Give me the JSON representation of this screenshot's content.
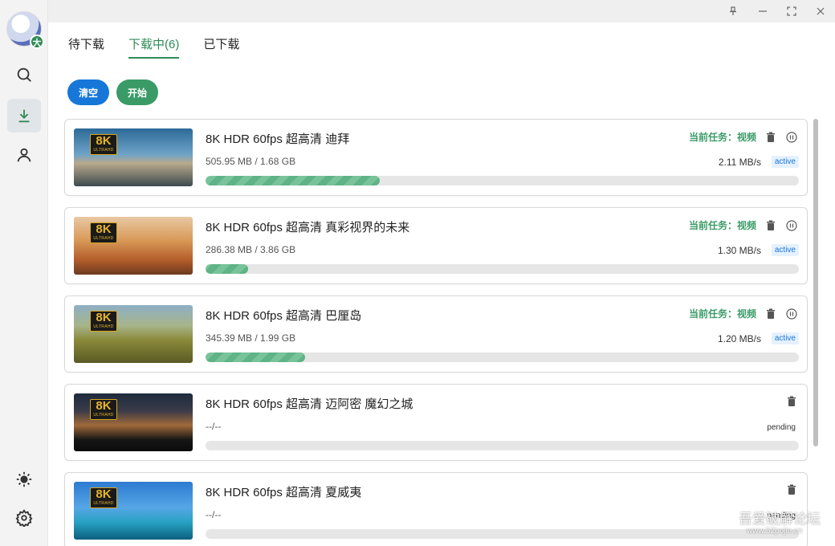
{
  "colors": {
    "accent": "#2e8b57",
    "blue": "#1677d9",
    "green_button": "#3a9b67",
    "sidebar_bg": "#f3f3f3"
  },
  "sidebar": {
    "avatar_badge": "大",
    "items": [
      {
        "icon": "search-icon"
      },
      {
        "icon": "download-icon"
      },
      {
        "icon": "user-icon"
      }
    ],
    "bottom_items": [
      {
        "icon": "sun-icon"
      },
      {
        "icon": "gear-icon"
      }
    ]
  },
  "window_controls": [
    "pin-icon",
    "minimize-icon",
    "restore-icon",
    "close-icon"
  ],
  "tabs": [
    {
      "label": "待下载"
    },
    {
      "label": "下载中(6)"
    },
    {
      "label": "已下载"
    }
  ],
  "actions": {
    "clear_label": "清空",
    "start_label": "开始"
  },
  "badge": {
    "big": "8K",
    "small": "ULTRAHD"
  },
  "downloads": [
    {
      "title": "8K HDR 60fps 超高清 迪拜",
      "size": "505.95 MB / 1.68 GB",
      "task_label": "当前任务：视频",
      "speed": "2.11 MB/s",
      "status": "active",
      "progress": 0.293
    },
    {
      "title": "8K HDR 60fps 超高清 真彩视界的未来",
      "size": "286.38 MB / 3.86 GB",
      "task_label": "当前任务：视频",
      "speed": "1.30 MB/s",
      "status": "active",
      "progress": 0.072
    },
    {
      "title": "8K HDR 60fps 超高清 巴厘岛",
      "size": "345.39 MB / 1.99 GB",
      "task_label": "当前任务：视频",
      "speed": "1.20 MB/s",
      "status": "active",
      "progress": 0.168
    },
    {
      "title": "8K HDR 60fps 超高清 迈阿密 魔幻之城",
      "size": "--/--",
      "status": "pending",
      "progress": 0
    },
    {
      "title": "8K HDR 60fps 超高清 夏威夷",
      "size": "--/--",
      "status": "pending",
      "progress": 0
    }
  ],
  "watermark": {
    "text": "吾爱破解论坛",
    "url": "www.52pojie.cn"
  }
}
